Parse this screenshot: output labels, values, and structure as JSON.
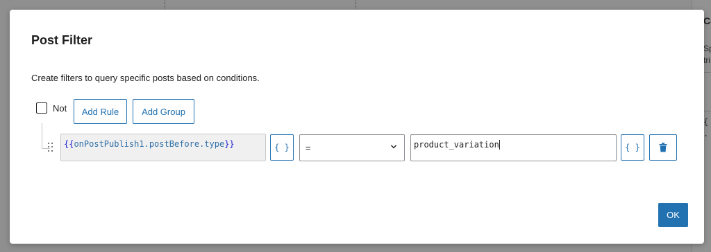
{
  "background": {
    "sidebar_title": "Co",
    "sidebar_text_1": "Sp",
    "sidebar_text_2": "tri",
    "sidebar_code_1": "{",
    "sidebar_code_2": "."
  },
  "modal": {
    "title": "Post Filter",
    "description": "Create filters to query specific posts based on conditions."
  },
  "group": {
    "not_label": "Not",
    "not_checked": false,
    "add_rule_label": "Add Rule",
    "add_group_label": "Add Group"
  },
  "rule": {
    "field_open": "{{",
    "field_value": "onPostPublish1.postBefore.type",
    "field_close": "}}",
    "vars_label": "{ }",
    "operator": "=",
    "value": "product_variation",
    "value_vars_label": "{ }"
  },
  "footer": {
    "ok_label": "OK"
  },
  "colors": {
    "accent": "#2271b1",
    "overlay": "#8c8c8c",
    "delete": "#2271b1"
  },
  "icons": [
    "checkbox",
    "drag-handle-icon",
    "chevron-down-icon",
    "trash-icon"
  ]
}
